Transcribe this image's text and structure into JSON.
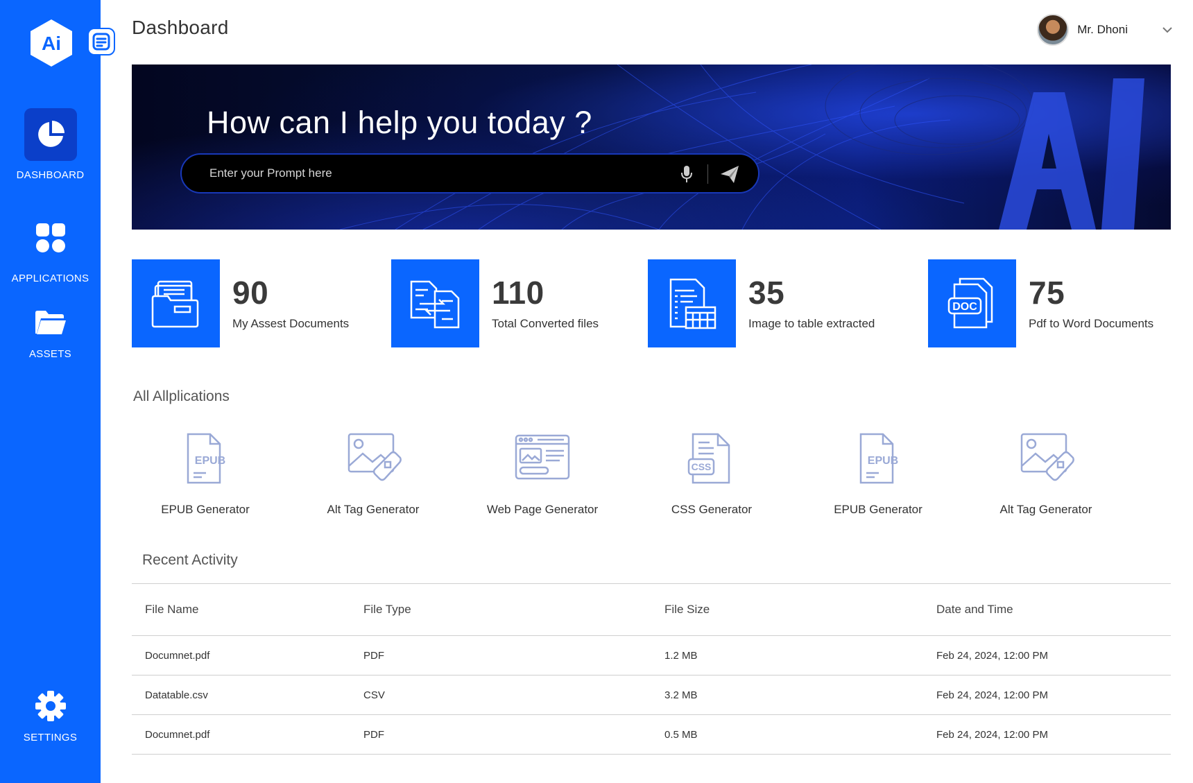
{
  "app": {
    "logo_text": "Ai"
  },
  "sidebar": {
    "items": [
      {
        "label": "DASHBOARD",
        "icon": "pie-chart-icon",
        "active": true
      },
      {
        "label": "APPLICATIONS",
        "icon": "grid-icon",
        "active": false
      },
      {
        "label": "ASSETS",
        "icon": "folder-icon",
        "active": false
      },
      {
        "label": "SETTINGS",
        "icon": "gear-icon",
        "active": false
      }
    ]
  },
  "header": {
    "title": "Dashboard",
    "user_name": "Mr. Dhoni"
  },
  "hero": {
    "title": "How can I help you today ?",
    "prompt_placeholder": "Enter your Prompt here"
  },
  "stats": [
    {
      "value": "90",
      "label": "My Assest Documents",
      "icon": "folder-documents-icon"
    },
    {
      "value": "110",
      "label": "Total Converted files",
      "icon": "convert-files-icon"
    },
    {
      "value": "35",
      "label": "Image to table extracted",
      "icon": "table-extract-icon"
    },
    {
      "value": "75",
      "label": "Pdf to Word Documents",
      "icon": "doc-file-icon"
    }
  ],
  "applications": {
    "title": "All Allplications",
    "items": [
      {
        "label": "EPUB Generator",
        "icon": "epub-file-icon"
      },
      {
        "label": "Alt Tag Generator",
        "icon": "image-tag-icon"
      },
      {
        "label": "Web Page Generator",
        "icon": "web-page-icon"
      },
      {
        "label": "CSS Generator",
        "icon": "css-file-icon"
      },
      {
        "label": "EPUB Generator",
        "icon": "epub-file-icon"
      },
      {
        "label": "Alt Tag Generator",
        "icon": "image-tag-icon"
      }
    ]
  },
  "recent": {
    "title": "Recent Activity",
    "columns": [
      "File Name",
      "File Type",
      "File Size",
      "Date and Time"
    ],
    "rows": [
      [
        "Documnet.pdf",
        "PDF",
        "1.2 MB",
        "Feb 24, 2024, 12:00 PM"
      ],
      [
        "Datatable.csv",
        "CSV",
        "3.2 MB",
        "Feb 24, 2024, 12:00 PM"
      ],
      [
        "Documnet.pdf",
        "PDF",
        "0.5 MB",
        "Feb 24, 2024, 12:00 PM"
      ]
    ]
  },
  "colors": {
    "primary": "#0a66ff",
    "active_nav": "#0b3fc9",
    "app_icon": "#9aa9d6"
  }
}
